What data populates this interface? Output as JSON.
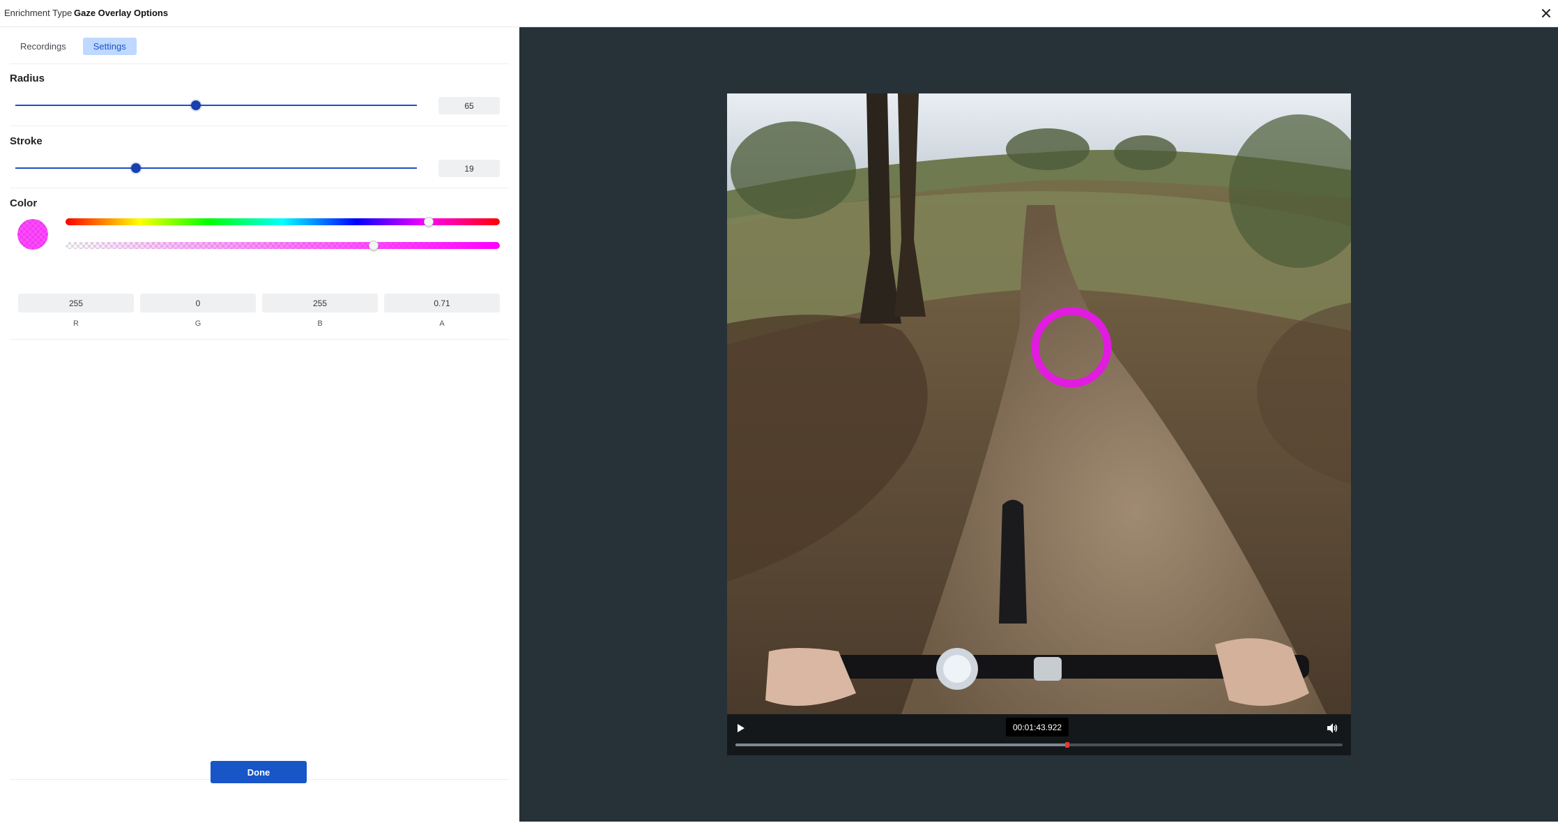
{
  "header": {
    "label": "Enrichment Type",
    "value": "Gaze Overlay Options"
  },
  "tabs": [
    {
      "label": "Recordings",
      "active": false
    },
    {
      "label": "Settings",
      "active": true
    }
  ],
  "radius": {
    "label": "Radius",
    "value": "65",
    "fraction": 0.45
  },
  "stroke": {
    "label": "Stroke",
    "value": "19",
    "fraction": 0.3
  },
  "color": {
    "label": "Color",
    "hex": "#ff00ff",
    "hue_fraction": 0.836,
    "alpha_fraction": 0.71,
    "channels": [
      {
        "label": "R",
        "value": "255"
      },
      {
        "label": "G",
        "value": "0"
      },
      {
        "label": "B",
        "value": "255"
      },
      {
        "label": "A",
        "value": "0.71"
      }
    ]
  },
  "done_label": "Done",
  "player": {
    "time": "00:01:43.922",
    "progress_fraction": 0.546
  },
  "icons": {
    "close": "close-icon",
    "play": "play-icon",
    "volume": "volume-icon"
  },
  "colors": {
    "accent": "#1856c8",
    "gaze": "#e11be0",
    "preview_bg": "#263238"
  }
}
